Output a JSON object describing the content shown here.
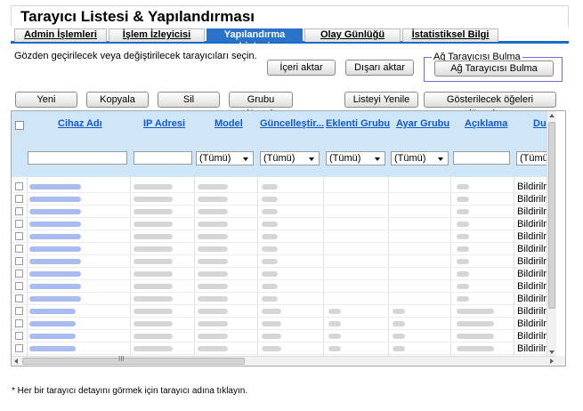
{
  "page": {
    "title": "Tarayıcı Listesi & Yapılandırması"
  },
  "tabs": [
    {
      "label": "Admin İşlemleri",
      "active": false
    },
    {
      "label": "İşlem İzleyicisi",
      "active": false
    },
    {
      "label": "Yapılandırma Listesi",
      "active": true
    },
    {
      "label": "Olay Günlüğü",
      "active": false
    },
    {
      "label": "İstatistiksel Bilgi",
      "active": false
    }
  ],
  "instruction": "Gözden geçirilecek veya değiştirilecek tarayıcıları seçin.",
  "toolbar_top": {
    "import_label": "İçeri aktar",
    "export_label": "Dışarı aktar"
  },
  "discovery": {
    "legend": "Ağ Tarayıcısı Bulma",
    "button_label": "Ağ Tarayıcısı Bulma"
  },
  "toolbar": {
    "new_label": "Yeni",
    "copy_label": "Kopyala",
    "delete_label": "Sil",
    "edit_group_label": "Grubu düzenle",
    "refresh_label": "Listeyi Yenile",
    "edit_columns_label": "Gösterilecek öğeleri düzenleme"
  },
  "table": {
    "columns": [
      "Cihaz Adı",
      "IP Adresi",
      "Model",
      "Güncelleştir...",
      "Eklenti Grubu",
      "Ayar Grubu",
      "Açıklama",
      "Duru"
    ],
    "filter_all": "(Tümü)",
    "status_value": "Bildirilme",
    "row_count": 15,
    "scroll_grip": "III"
  },
  "footnote": "* Her bir tarayıcı detayını görmek için tarayıcı adına tıklayın.",
  "colors": {
    "accent": "#2b73c8",
    "header_bg": "#cfe6f9",
    "link": "#1458c8",
    "redacted_link": "#a9bcf2",
    "redacted_text": "#d6d6d6"
  }
}
